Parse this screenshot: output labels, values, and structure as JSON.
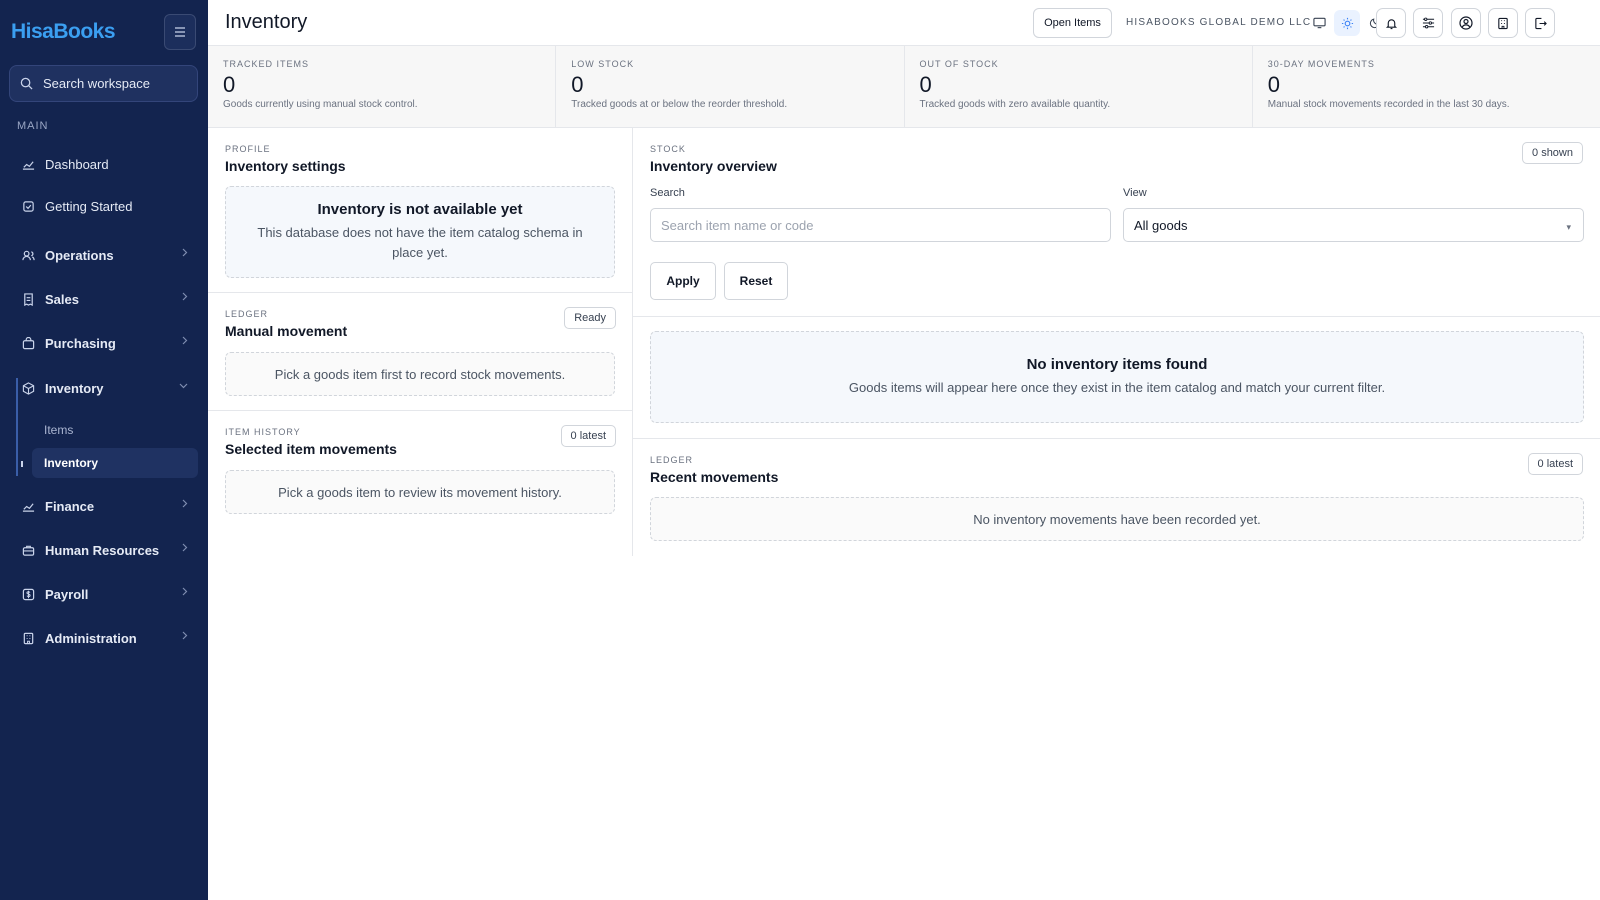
{
  "brand": {
    "part1": "Hisa",
    "part2": "Books"
  },
  "sidebar": {
    "search_placeholder": "Search workspace",
    "section_main": "MAIN",
    "items": {
      "dashboard": "Dashboard",
      "getting_started": "Getting Started",
      "operations": "Operations",
      "sales": "Sales",
      "purchasing": "Purchasing",
      "inventory": "Inventory",
      "finance": "Finance",
      "human_resources": "Human Resources",
      "payroll": "Payroll",
      "administration": "Administration"
    },
    "inventory_sub": {
      "items": "Items",
      "inventory": "Inventory"
    }
  },
  "header": {
    "title": "Inventory",
    "open_items": "Open Items",
    "company": "HISABOOKS GLOBAL DEMO LLC"
  },
  "stats": [
    {
      "label": "TRACKED ITEMS",
      "value": "0",
      "desc": "Goods currently using manual stock control."
    },
    {
      "label": "LOW STOCK",
      "value": "0",
      "desc": "Tracked goods at or below the reorder threshold."
    },
    {
      "label": "OUT OF STOCK",
      "value": "0",
      "desc": "Tracked goods with zero available quantity."
    },
    {
      "label": "30-DAY MOVEMENTS",
      "value": "0",
      "desc": "Manual stock movements recorded in the last 30 days."
    }
  ],
  "profile": {
    "eyebrow": "PROFILE",
    "title": "Inventory settings",
    "empty_title": "Inventory is not available yet",
    "empty_text": "This database does not have the item catalog schema in place yet."
  },
  "manual": {
    "eyebrow": "LEDGER",
    "title": "Manual movement",
    "badge": "Ready",
    "empty_text": "Pick a goods item first to record stock movements."
  },
  "history": {
    "eyebrow": "ITEM HISTORY",
    "title": "Selected item movements",
    "badge": "0 latest",
    "empty_text": "Pick a goods item to review its movement history."
  },
  "overview": {
    "eyebrow": "STOCK",
    "title": "Inventory overview",
    "badge": "0 shown",
    "search_label": "Search",
    "search_placeholder": "Search item name or code",
    "view_label": "View",
    "view_value": "All goods",
    "apply": "Apply",
    "reset": "Reset",
    "empty_title": "No inventory items found",
    "empty_text": "Goods items will appear here once they exist in the item catalog and match your current filter."
  },
  "recent": {
    "eyebrow": "LEDGER",
    "title": "Recent movements",
    "badge": "0 latest",
    "empty_text": "No inventory movements have been recorded yet."
  }
}
